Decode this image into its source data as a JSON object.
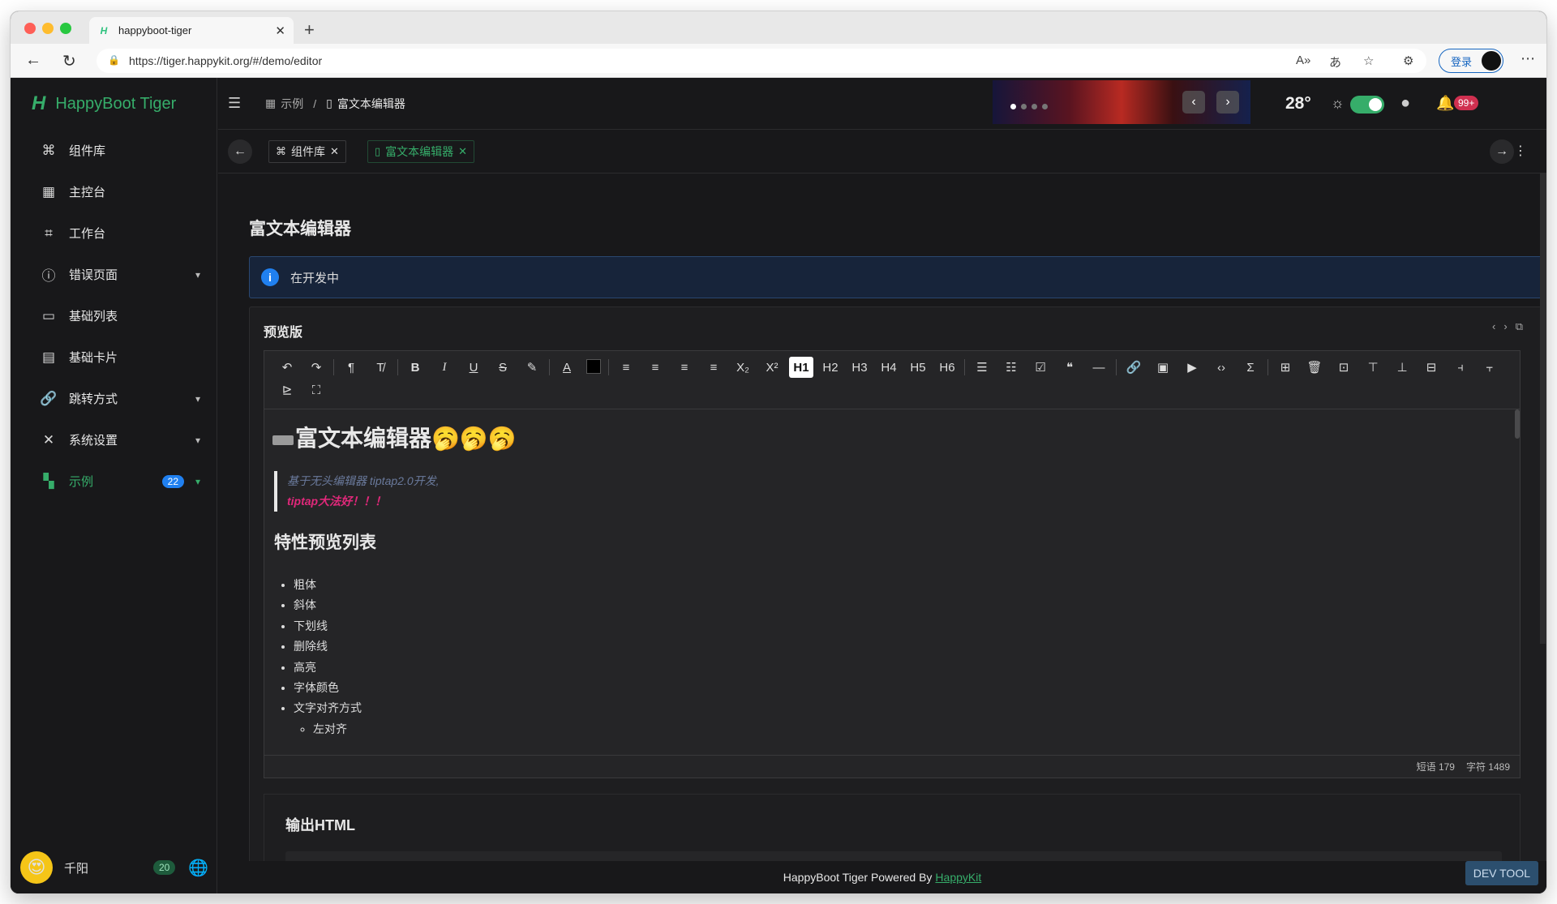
{
  "browser": {
    "tab_title": "happyboot-tiger",
    "url": "https://tiger.happykit.org/#/demo/editor",
    "login_label": "登录"
  },
  "sidebar": {
    "brand": "HappyBoot Tiger",
    "items": [
      {
        "label": "组件库",
        "icon": "command-icon"
      },
      {
        "label": "主控台",
        "icon": "dashboard-icon"
      },
      {
        "label": "工作台",
        "icon": "workbench-icon"
      },
      {
        "label": "错误页面",
        "icon": "error-icon"
      },
      {
        "label": "基础列表",
        "icon": "list-icon"
      },
      {
        "label": "基础卡片",
        "icon": "card-icon"
      },
      {
        "label": "跳转方式",
        "icon": "link-icon"
      },
      {
        "label": "系统设置",
        "icon": "tools-icon"
      },
      {
        "label": "示例",
        "icon": "example-icon",
        "badge": "22"
      }
    ],
    "user": {
      "name": "千阳",
      "badge": "20"
    }
  },
  "header": {
    "breadcrumb": [
      "示例",
      "富文本编辑器"
    ],
    "temperature": "28°",
    "notifications": "99+"
  },
  "tabs": [
    "组件库",
    "富文本编辑器"
  ],
  "page": {
    "title": "富文本编辑器",
    "alert": "在开发中",
    "card_title": "预览版"
  },
  "editor": {
    "doc_title": "富文本编辑器🥱🥱🥱",
    "quote_line1": "基于无头编辑器 tiptap2.0开发,",
    "quote_line2": "tiptap大法好！！！",
    "section_title": "特性预览列表",
    "features": [
      "粗体",
      "斜体",
      "下划线",
      "删除线",
      "高亮",
      "字体颜色",
      "文字对齐方式"
    ],
    "sub_features": [
      "左对齐"
    ],
    "words": "短语 179",
    "chars": "字符 1489"
  },
  "output": {
    "title": "输出HTML"
  },
  "footer": {
    "text": "HappyBoot Tiger Powered By",
    "link": "HappyKit",
    "devtool": "DEV TOOL"
  },
  "colors": {
    "accent": "#36ad6a",
    "info": "#2080f0",
    "danger": "#d03050",
    "quote_pink": "#e0287a"
  }
}
